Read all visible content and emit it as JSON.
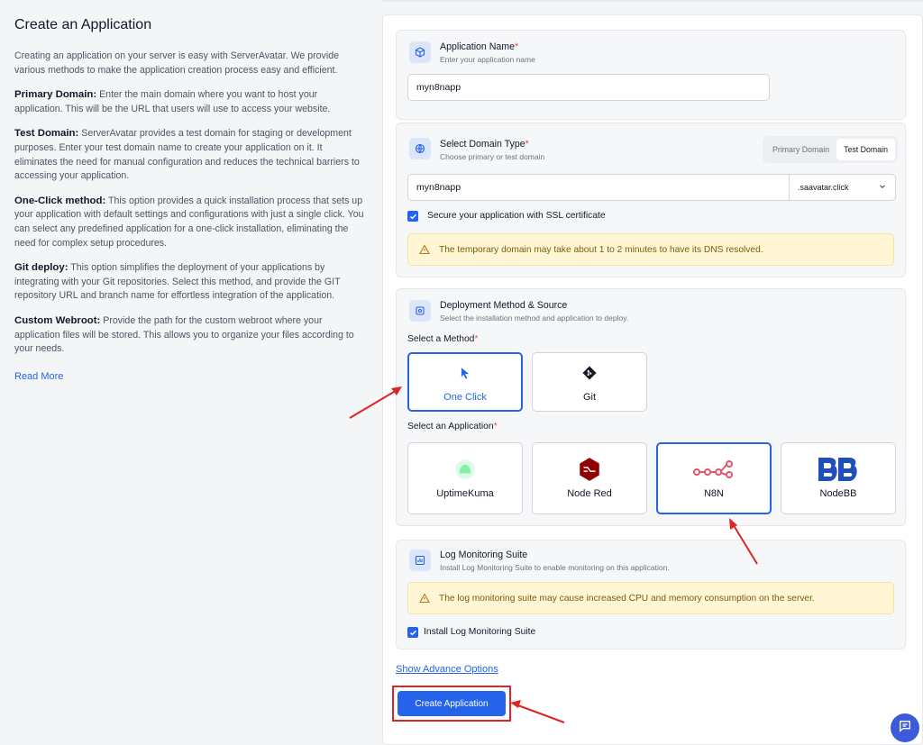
{
  "left": {
    "title": "Create an Application",
    "intro": "Creating an application on your server is easy with ServerAvatar. We provide various methods to make the application creation process easy and efficient.",
    "sections": [
      {
        "term": "Primary Domain:",
        "text": "Enter the main domain where you want to host your application. This will be the URL that users will use to access your website."
      },
      {
        "term": "Test Domain:",
        "text": "ServerAvatar provides a test domain for staging or development purposes. Enter your test domain name to create your application on it. It eliminates the need for manual configuration and reduces the technical barriers to accessing your application."
      },
      {
        "term": "One-Click method:",
        "text": "This option provides a quick installation process that sets up your application with default settings and configurations with just a single click. You can select any predefined application for a one-click installation, eliminating the need for complex setup procedures."
      },
      {
        "term": "Git deploy:",
        "text": "This option simplifies the deployment of your applications by integrating with your Git repositories. Select this method, and provide the GIT repository URL and branch name for effortless integration of the application."
      },
      {
        "term": "Custom Webroot:",
        "text": "Provide the path for the custom webroot where your application files will be stored. This allows you to organize your files according to your needs."
      }
    ],
    "read_more": "Read More"
  },
  "app_name": {
    "title": "Application Name",
    "required": "*",
    "subtitle": "Enter your application name",
    "value": "myn8napp"
  },
  "domain": {
    "title": "Select Domain Type",
    "required": "*",
    "subtitle": "Choose primary or test domain",
    "options": [
      "Primary Domain",
      "Test Domain"
    ],
    "selected": "Test Domain",
    "value": "myn8napp",
    "suffix": ".saavatar.click",
    "ssl_label": "Secure your application with SSL certificate",
    "warning": "The temporary domain may take about 1 to 2 minutes to have its DNS resolved."
  },
  "deploy": {
    "title": "Deployment Method & Source",
    "subtitle": "Select the installation method and application to deploy.",
    "method_label": "Select a Method",
    "methods": [
      "One Click",
      "Git"
    ],
    "selected_method": "One Click",
    "app_label": "Select an Application",
    "apps": [
      "UptimeKuma",
      "Node Red",
      "N8N",
      "NodeBB"
    ],
    "selected_app": "N8N",
    "required": "*"
  },
  "log": {
    "title": "Log Monitoring Suite",
    "subtitle": "Install Log Monitoring Suite to enable monitoring on this application.",
    "warning": "The log monitoring suite may cause increased CPU and memory consumption on the server.",
    "checkbox_label": "Install Log Monitoring Suite"
  },
  "footer": {
    "advanced": "Show Advance Options",
    "create": "Create Application"
  },
  "colors": {
    "accent": "#2563eb",
    "warning_bg": "#fef6d4",
    "annotation": "#dc2626"
  }
}
